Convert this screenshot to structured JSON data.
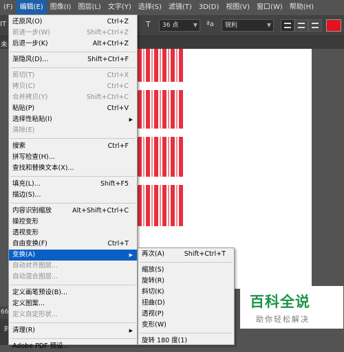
{
  "menubar": {
    "items": [
      "(F)",
      "编辑(E)",
      "图像(I)",
      "图层(L)",
      "文字(Y)",
      "选择(S)",
      "滤镜(T)",
      "3D(D)",
      "视图(V)",
      "窗口(W)",
      "帮助(H)"
    ]
  },
  "options": {
    "tool_glyph": "IT",
    "font_size": "36 点",
    "aa_glyph": "ªa",
    "antialias": "锐利",
    "text_color": "#e4121c"
  },
  "tabbar": {
    "tab_fragment": "未"
  },
  "status": {
    "zoom_fragment": "66.",
    "timeline_fragment": "时"
  },
  "edit_menu": {
    "items": [
      {
        "label": "还原风(O)",
        "shortcut": "Ctrl+Z"
      },
      {
        "label": "前进一步(W)",
        "shortcut": "Shift+Ctrl+Z",
        "disabled": true
      },
      {
        "label": "后退一步(K)",
        "shortcut": "Alt+Ctrl+Z"
      },
      {
        "label": "渐隐风(D)...",
        "shortcut": "Shift+Ctrl+F"
      },
      {
        "label": "剪切(T)",
        "shortcut": "Ctrl+X",
        "disabled": true
      },
      {
        "label": "拷贝(C)",
        "shortcut": "Ctrl+C",
        "disabled": true
      },
      {
        "label": "合并拷贝(Y)",
        "shortcut": "Shift+Ctrl+C",
        "disabled": true
      },
      {
        "label": "粘贴(P)",
        "shortcut": "Ctrl+V"
      },
      {
        "label": "选择性粘贴(I)",
        "shortcut": ""
      },
      {
        "label": "清除(E)",
        "shortcut": "",
        "disabled": true
      },
      {
        "label": "搜索",
        "shortcut": "Ctrl+F"
      },
      {
        "label": "拼写检查(H)...",
        "shortcut": ""
      },
      {
        "label": "查找和替换文本(X)...",
        "shortcut": ""
      },
      {
        "label": "填充(L)...",
        "shortcut": "Shift+F5"
      },
      {
        "label": "描边(S)...",
        "shortcut": ""
      },
      {
        "label": "内容识别缩放",
        "shortcut": "Alt+Shift+Ctrl+C"
      },
      {
        "label": "操控变形",
        "shortcut": ""
      },
      {
        "label": "透视变形",
        "shortcut": ""
      },
      {
        "label": "自由变换(F)",
        "shortcut": "Ctrl+T"
      },
      {
        "label": "变换(A)",
        "shortcut": ""
      },
      {
        "label": "自动对齐图层...",
        "shortcut": "",
        "disabled": true
      },
      {
        "label": "自动混合图层...",
        "shortcut": "",
        "disabled": true
      },
      {
        "label": "定义画笔预设(B)...",
        "shortcut": ""
      },
      {
        "label": "定义图案...",
        "shortcut": ""
      },
      {
        "label": "定义自定形状...",
        "shortcut": "",
        "disabled": true
      },
      {
        "label": "清理(R)",
        "shortcut": ""
      },
      {
        "label": "Adobe PDF 预设...",
        "shortcut": ""
      }
    ]
  },
  "transform_menu": {
    "items": [
      {
        "label": "再次(A)",
        "shortcut": "Shift+Ctrl+T"
      },
      {
        "label": "缩放(S)",
        "shortcut": ""
      },
      {
        "label": "旋转(R)",
        "shortcut": ""
      },
      {
        "label": "斜切(K)",
        "shortcut": ""
      },
      {
        "label": "扭曲(D)",
        "shortcut": ""
      },
      {
        "label": "透视(P)",
        "shortcut": ""
      },
      {
        "label": "变形(W)",
        "shortcut": ""
      },
      {
        "label": "旋转 180 度(1)",
        "shortcut": ""
      }
    ]
  },
  "watermark": {
    "title": "百科全说",
    "subtitle": "助你轻松解决"
  },
  "colors": {
    "accent": "#0a5fc5",
    "menu_bg": "#f0f0f0",
    "app_bg": "#535353",
    "watermark_green": "#1b9448"
  }
}
